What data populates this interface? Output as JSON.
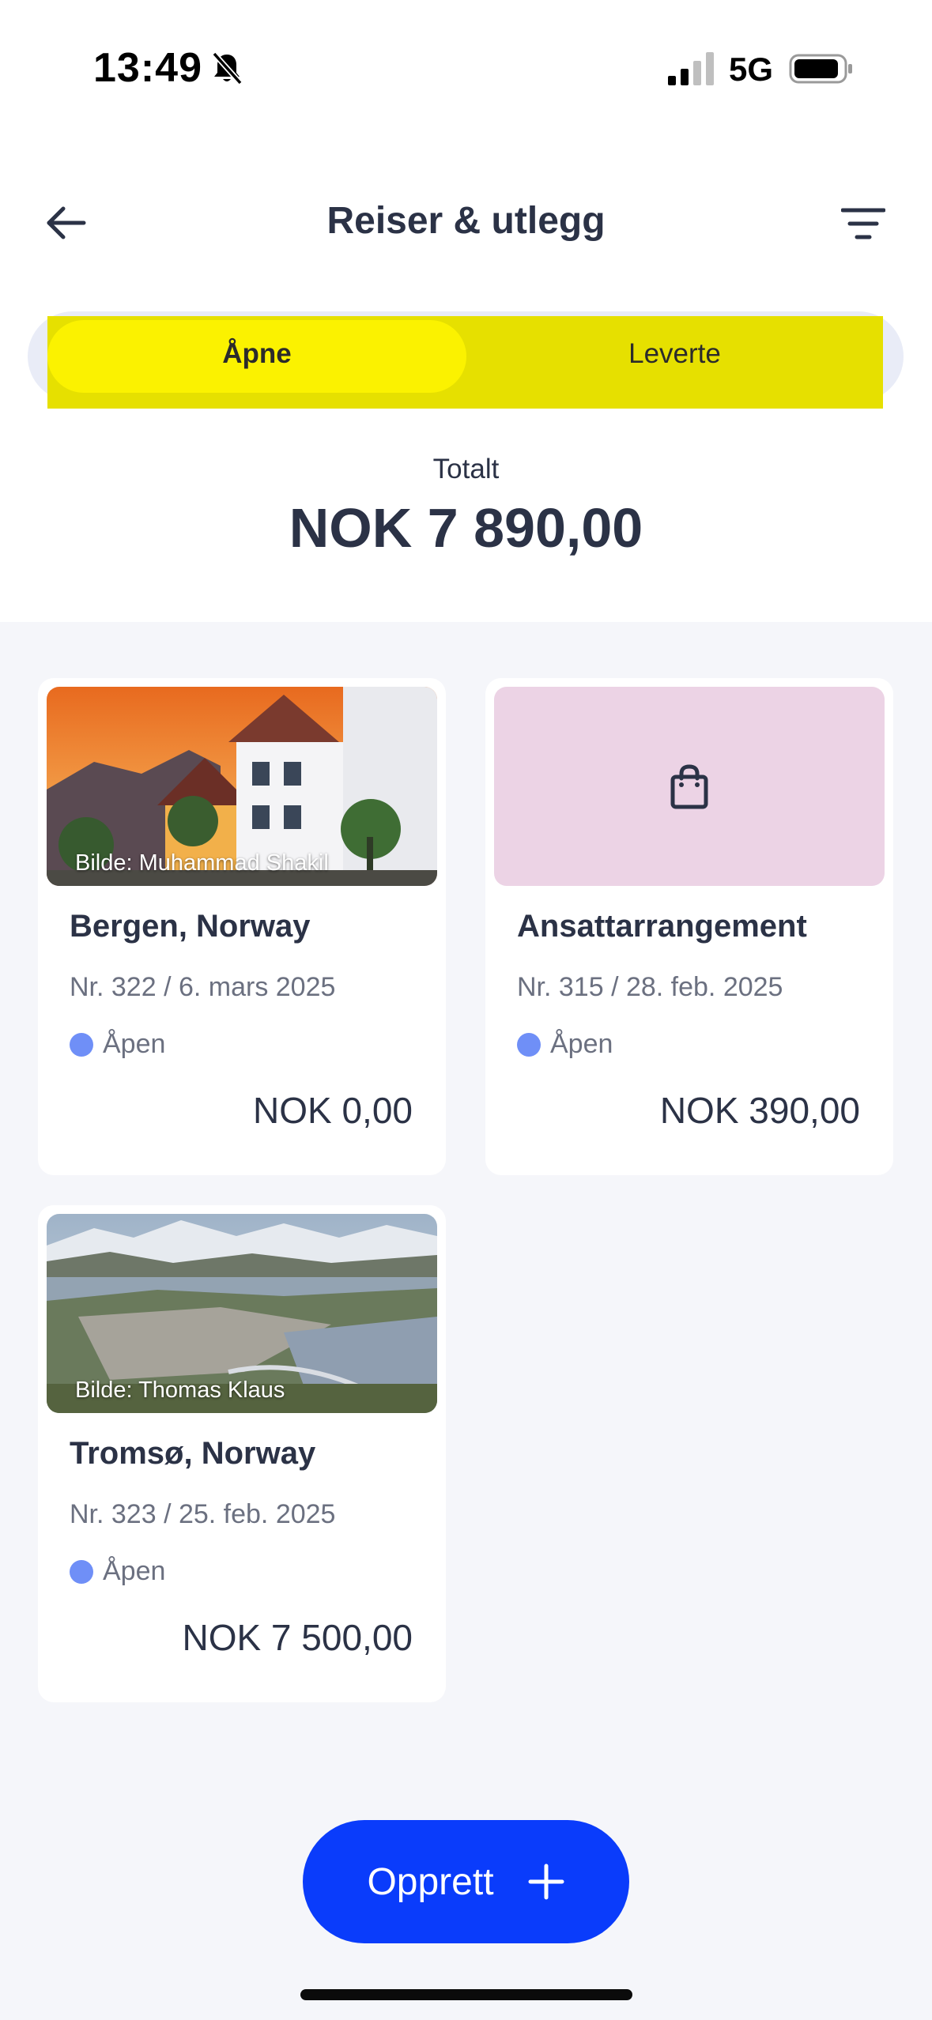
{
  "status_bar": {
    "time": "13:49",
    "network": "5G"
  },
  "header": {
    "title": "Reiser & utlegg"
  },
  "tabs": [
    {
      "label": "Åpne",
      "selected": true
    },
    {
      "label": "Leverte",
      "selected": false
    }
  ],
  "summary": {
    "label": "Totalt",
    "amount": "NOK 7 890,00"
  },
  "cards": [
    {
      "title": "Bergen, Norway",
      "meta": "Nr. 322 / 6. mars 2025",
      "status": "Åpen",
      "amount": "NOK 0,00",
      "photo_credit": "Bilde: Muhammad Shakil"
    },
    {
      "title": "Ansattarrangement",
      "meta": "Nr. 315 / 28. feb. 2025",
      "status": "Åpen",
      "amount": "NOK 390,00",
      "icon": "shopping-bag-icon"
    },
    {
      "title": "Tromsø, Norway",
      "meta": "Nr. 323 / 25. feb. 2025",
      "status": "Åpen",
      "amount": "NOK 7 500,00",
      "photo_credit": "Bilde: Thomas Klaus"
    }
  ],
  "create_button": {
    "label": "Opprett"
  },
  "colors": {
    "primary": "#0a3cfb",
    "status_open": "#6f8ff7",
    "highlight": "#fbf200",
    "placeholder_bg": "#ecd3e5"
  }
}
